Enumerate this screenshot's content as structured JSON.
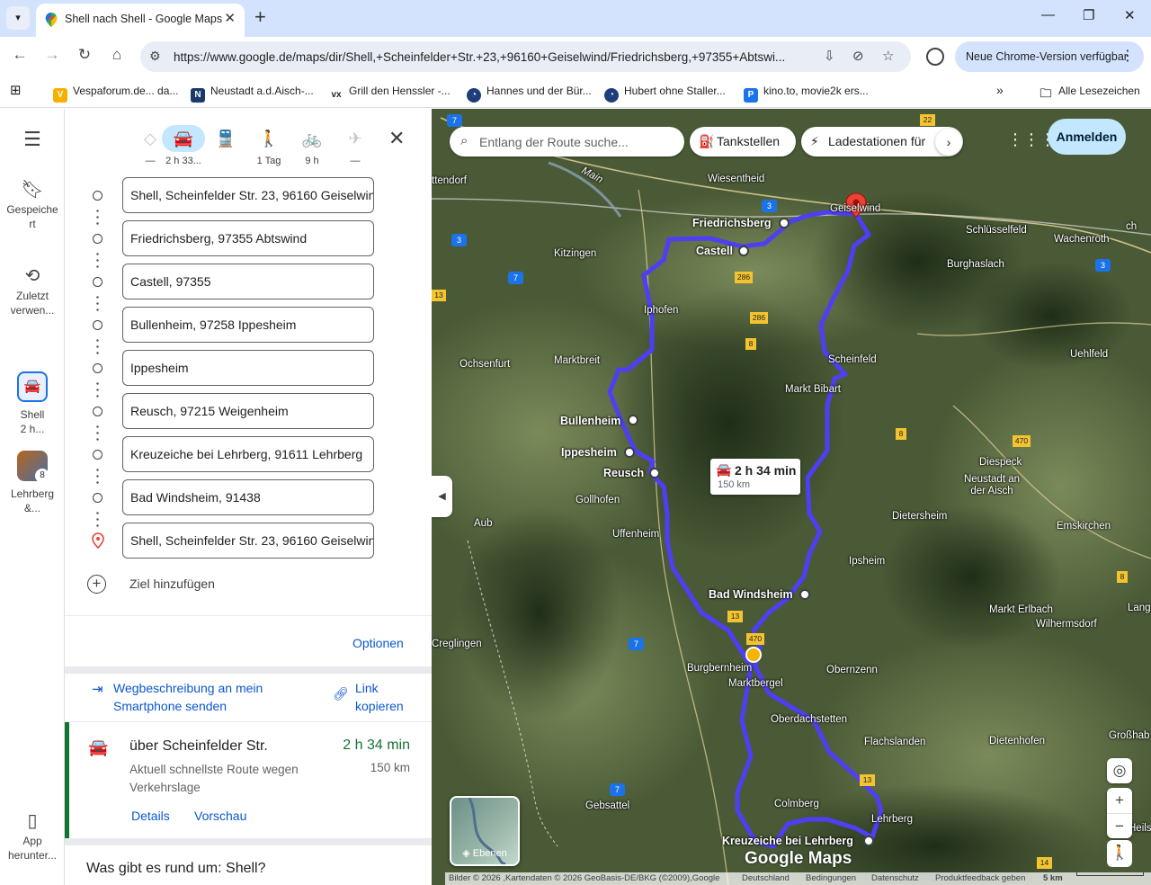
{
  "browser": {
    "tab_title": "Shell nach Shell - Google Maps",
    "url": "https://www.google.de/maps/dir/Shell,+Scheinfelder+Str.+23,+96160+Geiselwind/Friedrichsberg,+97355+Abtswi...",
    "update_label": "Neue Chrome-Version verfügbar",
    "bookmarks": [
      "Vespaforum.de... da...",
      "Neustadt a.d.Aisch-...",
      "Grill den Henssler -...",
      "Hannes und der Bür...",
      "Hubert ohne Staller...",
      "kino.to, movie2k ers..."
    ],
    "all_bookmarks": "Alle Lesezeichen"
  },
  "rail": {
    "saved": "Gespeichert",
    "recent": "Zuletzt verwen...",
    "shell_label": "Shell",
    "shell_time": "2 h...",
    "lehrberg_label": "Lehrberg &...",
    "lehrberg_count": "8",
    "app": "App herunter..."
  },
  "modes": [
    {
      "name": "best",
      "label": "—",
      "glyph": "◇"
    },
    {
      "name": "car",
      "label": "2 h 33...",
      "glyph": "🚘"
    },
    {
      "name": "transit",
      "label": "",
      "glyph": "🚆"
    },
    {
      "name": "walk",
      "label": "1 Tag",
      "glyph": "🚶"
    },
    {
      "name": "bike",
      "label": "9 h",
      "glyph": "🚲"
    },
    {
      "name": "flight",
      "label": "—",
      "glyph": "✈"
    }
  ],
  "waypoints": [
    "Shell, Scheinfelder Str. 23, 96160 Geiselwind",
    "Friedrichsberg, 97355 Abtswind",
    "Castell, 97355",
    "Bullenheim, 97258 Ippesheim",
    "Ippesheim",
    "Reusch, 97215 Weigenheim",
    "Kreuzeiche bei Lehrberg, 91611 Lehrberg",
    "Bad Windsheim, 91438",
    "Shell, Scheinfelder Str. 23, 96160 Geiselwind"
  ],
  "add_destination": "Ziel hinzufügen",
  "options": "Optionen",
  "send_to_phone": "Wegbeschreibung an mein Smartphone senden",
  "copy_link": "Link kopieren",
  "route": {
    "title": "über Scheinfelder Str.",
    "time": "2 h 34 min",
    "desc": "Aktuell schnellste Route wegen Verkehrslage",
    "distance": "150 km",
    "details": "Details",
    "preview": "Vorschau"
  },
  "around": "Was gibt es rund um: Shell?",
  "map": {
    "search_placeholder": "Entlang der Route suche...",
    "chip_gas": "Tankstellen",
    "chip_charge": "Ladestationen für",
    "signin": "Anmelden",
    "tooltip_time": "2 h 34 min",
    "tooltip_dist": "150 km",
    "layers": "Ebenen",
    "logo": "Google Maps",
    "footer": {
      "imagery": "Bilder © 2026 ,Kartendaten © 2026 GeoBasis-DE/BKG (©2009),Google",
      "country": "Deutschland",
      "terms": "Bedingungen",
      "privacy": "Datenschutz",
      "feedback": "Produktfeedback geben",
      "scale": "5 km"
    },
    "places": {
      "wiesentheid": "Wiesentheid",
      "friedrichsberg": "Friedrichsberg",
      "geiselwind": "Geiselwind",
      "castell": "Castell",
      "kitzingen": "Kitzingen",
      "schluesselfeld": "Schlüsselfeld",
      "wachenroth": "Wachenroth",
      "burghaslach": "Burghaslach",
      "iphofen": "Iphofen",
      "ochsenfurt": "Ochsenfurt",
      "marktbreit": "Marktbreit",
      "scheinfeld": "Scheinfeld",
      "marktbibart": "Markt Bibart",
      "uehlfeld": "Uehlfeld",
      "bullenheim": "Bullenheim",
      "ippesheim": "Ippesheim",
      "reusch": "Reusch",
      "diespeck": "Diespeck",
      "neustadt": "Neustadt an der Aisch",
      "gollhofen": "Gollhofen",
      "aub": "Aub",
      "uffenheim": "Uffenheim",
      "dietersheim": "Dietersheim",
      "emskirchen": "Emskirchen",
      "ipsheim": "Ipsheim",
      "badwindsheim": "Bad Windsheim",
      "markterlbach": "Markt Erlbach",
      "wilhermsdorf": "Wilhermsdorf",
      "creglingen": "Creglingen",
      "burgbernheim": "Burgbernheim",
      "obernzenn": "Obernzenn",
      "marktbergel": "Marktbergel",
      "oberdachstetten": "Oberdachstetten",
      "flachslanden": "Flachslanden",
      "dietenhofen": "Dietenhofen",
      "grosshab": "Großhab",
      "gebsattel": "Gebsattel",
      "colmberg": "Colmberg",
      "lehrberg": "Lehrberg",
      "kreuzeiche": "Kreuzeiche bei Lehrberg",
      "main": "Main",
      "ttendorf": "ttendorf",
      "lang": "Lang",
      "heils": "Heils",
      "ch": "ch"
    },
    "road_numbers": {
      "r7": "7",
      "r22": "22",
      "r3a": "3",
      "r3b": "3",
      "r3c": "3",
      "r13a": "13",
      "r286a": "286",
      "r286b": "286",
      "r8a": "8",
      "r8b": "8",
      "r8c": "8",
      "r470a": "470",
      "r470b": "470",
      "r13b": "13",
      "r7b": "7",
      "r7c": "7",
      "r13c": "13",
      "r14": "14"
    }
  }
}
